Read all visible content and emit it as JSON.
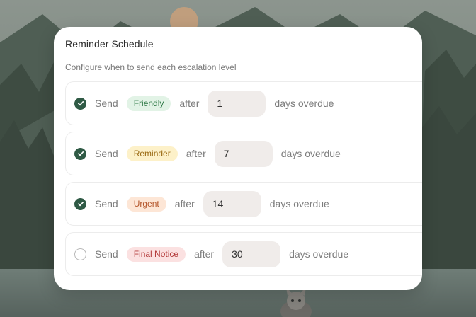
{
  "colors": {
    "accent": "#2f5a45",
    "friendly_bg": "#e2f3e6",
    "friendly_fg": "#2f7a47",
    "reminder_bg": "#fdf1c9",
    "reminder_fg": "#9a6a12",
    "urgent_bg": "#fde6d6",
    "urgent_fg": "#b4552a",
    "final_bg": "#fbe1e1",
    "final_fg": "#b33a3a"
  },
  "card": {
    "title": "Reminder Schedule",
    "subtitle": "Configure when to send each escalation level"
  },
  "rows": [
    {
      "checked": true,
      "send_label": "Send",
      "level": "Friendly",
      "after_label": "after",
      "days": "1",
      "suffix": "days overdue"
    },
    {
      "checked": true,
      "send_label": "Send",
      "level": "Reminder",
      "after_label": "after",
      "days": "7",
      "suffix": "days overdue"
    },
    {
      "checked": true,
      "send_label": "Send",
      "level": "Urgent",
      "after_label": "after",
      "days": "14",
      "suffix": "days overdue"
    },
    {
      "checked": false,
      "send_label": "Send",
      "level": "Final Notice",
      "after_label": "after",
      "days": "30",
      "suffix": "days overdue"
    }
  ]
}
